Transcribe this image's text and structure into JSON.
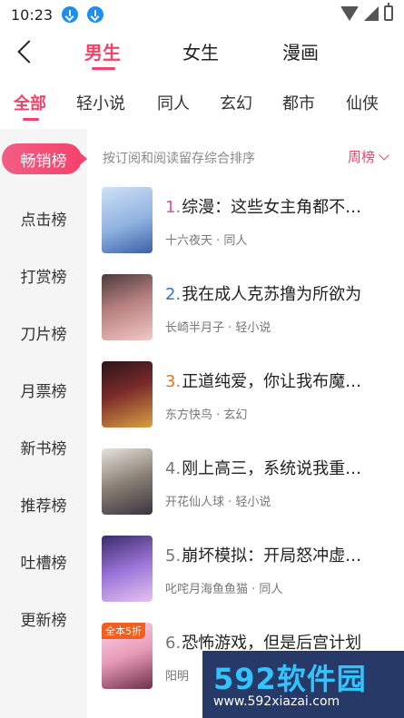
{
  "status": {
    "time": "10:23"
  },
  "header": {
    "tabs": [
      {
        "label": "男生",
        "active": true
      },
      {
        "label": "女生",
        "active": false
      },
      {
        "label": "漫画",
        "active": false
      }
    ]
  },
  "categories": [
    "全部",
    "轻小说",
    "同人",
    "玄幻",
    "都市",
    "仙侠"
  ],
  "sidebar": [
    "畅销榜",
    "点击榜",
    "打赏榜",
    "刀片榜",
    "月票榜",
    "新书榜",
    "推荐榜",
    "吐槽榜",
    "更新榜"
  ],
  "main": {
    "sort_desc": "按订阅和阅读留存综合排序",
    "period": "周榜"
  },
  "books": [
    {
      "rank": "1.",
      "title": "综漫：这些女主角都不…",
      "author": "十六夜天",
      "genre": "同人",
      "rank_color": "#e94fa6"
    },
    {
      "rank": "2.",
      "title": "我在成人克苏撸为所欲为",
      "author": "长崎半月子",
      "genre": "轻小说",
      "rank_color": "#3b6ec9"
    },
    {
      "rank": "3.",
      "title": "正道纯爱，你让我布魔…",
      "author": "东方快鸟",
      "genre": "玄幻",
      "rank_color": "#e0781f"
    },
    {
      "rank": "4.",
      "title": "刚上高三，系统说我重…",
      "author": "开花仙人球",
      "genre": "轻小说",
      "rank_color": "#777777"
    },
    {
      "rank": "5.",
      "title": "崩坏模拟：开局怒冲虚…",
      "author": "叱咤月海鱼鱼猫",
      "genre": "同人",
      "rank_color": "#777777"
    },
    {
      "rank": "6.",
      "title": "恐怖游戏，但是后宫计划",
      "author": "阳明",
      "genre": "",
      "rank_color": "#777777",
      "badge": "全本5折"
    }
  ],
  "watermark": {
    "brand": "592软件园",
    "url": "www.592xiazai.com"
  },
  "colors": {
    "accent": "#f4426b"
  }
}
